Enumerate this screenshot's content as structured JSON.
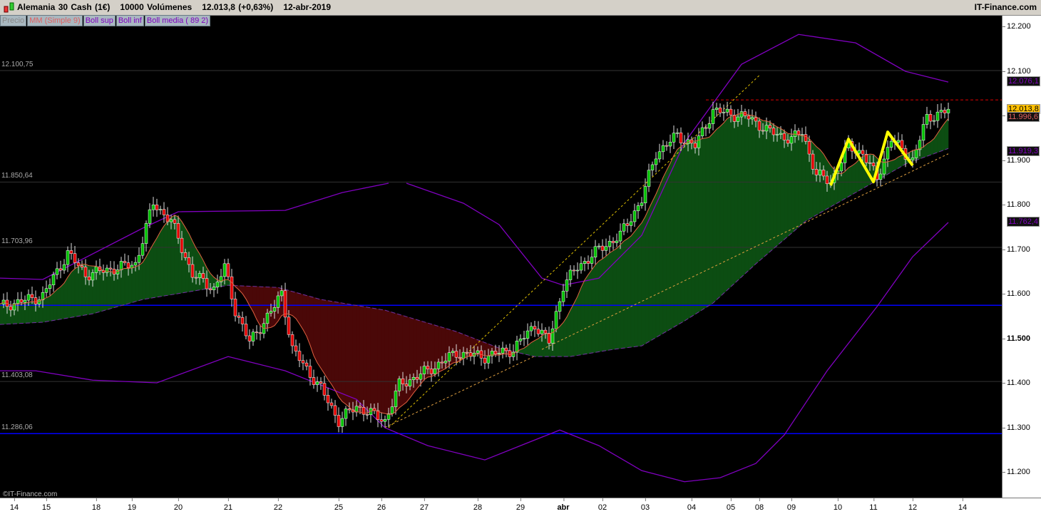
{
  "header": {
    "instrument": "Alemania 30 Cash (1€)",
    "volume": "10000 Volúmenes",
    "last": "12.013,8 (+0,63%)",
    "date": "12-abr-2019",
    "brand": "IT-Finance.com"
  },
  "legend": [
    {
      "label": "Precio",
      "color": "#888888"
    },
    {
      "label": "MM (Simple 9)",
      "color": "#e06060"
    },
    {
      "label": "Boll sup",
      "color": "#8000c0"
    },
    {
      "label": "Boll inf",
      "color": "#8000c0"
    },
    {
      "label": "Boll media ( 89 2)",
      "color": "#8000c0"
    }
  ],
  "copyright": "©IT-Finance.com",
  "levels": [
    {
      "label": "12.100,75",
      "price": 12100.75,
      "color": "#333333"
    },
    {
      "label": "11.850,64",
      "price": 11850.64,
      "color": "#333333"
    },
    {
      "label": "11.703,96",
      "price": 11703.96,
      "color": "#333333"
    },
    {
      "label": "11.403,08",
      "price": 11403.08,
      "color": "#333333"
    },
    {
      "label": "11.286,06",
      "price": 11286.06,
      "color": "#0000ff"
    }
  ],
  "chart_data": {
    "type": "candlestick",
    "title": "Alemania 30 Cash (1€)",
    "ylim": [
      11100,
      12230
    ],
    "yticks": [
      "12.200",
      "12.100",
      "12.000",
      "11.900",
      "11.800",
      "11.700",
      "11.600",
      "11.500",
      "11.400",
      "11.300",
      "11.200"
    ],
    "ytick_values": [
      12200,
      12100,
      12000,
      11900,
      11800,
      11700,
      11600,
      11500,
      11400,
      11300,
      11200
    ],
    "xticks": [
      {
        "label": "14",
        "bar": 4
      },
      {
        "label": "15",
        "bar": 13
      },
      {
        "label": "18",
        "bar": 27
      },
      {
        "label": "19",
        "bar": 37
      },
      {
        "label": "20",
        "bar": 50
      },
      {
        "label": "21",
        "bar": 64
      },
      {
        "label": "22",
        "bar": 78
      },
      {
        "label": "25",
        "bar": 95
      },
      {
        "label": "26",
        "bar": 107
      },
      {
        "label": "27",
        "bar": 119
      },
      {
        "label": "28",
        "bar": 134
      },
      {
        "label": "29",
        "bar": 146
      },
      {
        "label": "abr",
        "bar": 158
      },
      {
        "label": "02",
        "bar": 169
      },
      {
        "label": "03",
        "bar": 181
      },
      {
        "label": "04",
        "bar": 194
      },
      {
        "label": "05",
        "bar": 205
      },
      {
        "label": "08",
        "bar": 213
      },
      {
        "label": "09",
        "bar": 222
      },
      {
        "label": "10",
        "bar": 235
      },
      {
        "label": "11",
        "bar": 245
      },
      {
        "label": "12",
        "bar": 256
      },
      {
        "label": "14",
        "bar": 270
      }
    ],
    "close": [
      [
        0,
        11571
      ],
      [
        12,
        11595
      ],
      [
        19,
        11691
      ],
      [
        24,
        11643
      ],
      [
        38,
        11667
      ],
      [
        43,
        11803
      ],
      [
        48,
        11763
      ],
      [
        54,
        11643
      ],
      [
        60,
        11611
      ],
      [
        63,
        11659
      ],
      [
        66,
        11563
      ],
      [
        70,
        11491
      ],
      [
        77,
        11571
      ],
      [
        79,
        11603
      ],
      [
        82,
        11475
      ],
      [
        90,
        11387
      ],
      [
        95,
        11315
      ],
      [
        100,
        11347
      ],
      [
        108,
        11315
      ],
      [
        112,
        11395
      ],
      [
        120,
        11427
      ],
      [
        128,
        11467
      ],
      [
        136,
        11459
      ],
      [
        144,
        11475
      ],
      [
        150,
        11531
      ],
      [
        154,
        11491
      ],
      [
        158,
        11619
      ],
      [
        162,
        11659
      ],
      [
        168,
        11699
      ],
      [
        174,
        11731
      ],
      [
        180,
        11811
      ],
      [
        184,
        11915
      ],
      [
        190,
        11955
      ],
      [
        195,
        11931
      ],
      [
        200,
        12011
      ],
      [
        210,
        11995
      ],
      [
        216,
        11963
      ],
      [
        222,
        11947
      ],
      [
        225,
        11963
      ],
      [
        229,
        11867
      ],
      [
        233,
        11851
      ],
      [
        238,
        11931
      ],
      [
        242,
        11915
      ],
      [
        246,
        11859
      ],
      [
        250,
        11947
      ],
      [
        256,
        11899
      ],
      [
        260,
        11995
      ],
      [
        266,
        12011
      ]
    ],
    "boll_sup": [
      [
        0,
        11635
      ],
      [
        12,
        11632
      ],
      [
        40,
        11747
      ],
      [
        50,
        11784
      ],
      [
        80,
        11787
      ],
      [
        96,
        11827
      ],
      [
        109,
        11848
      ]
    ],
    "boll_sup_2": [
      [
        114,
        11848
      ],
      [
        130,
        11803
      ],
      [
        140,
        11755
      ],
      [
        152,
        11635
      ],
      [
        158,
        11619
      ],
      [
        168,
        11635
      ],
      [
        180,
        11731
      ],
      [
        192,
        11939
      ],
      [
        208,
        12115
      ],
      [
        224,
        12182
      ],
      [
        240,
        12163
      ],
      [
        254,
        12099
      ],
      [
        266,
        12075
      ]
    ],
    "boll_inf": [
      [
        0,
        11427
      ],
      [
        10,
        11427
      ],
      [
        26,
        11406
      ],
      [
        44,
        11400
      ],
      [
        64,
        11459
      ],
      [
        80,
        11427
      ],
      [
        100,
        11363
      ],
      [
        108,
        11299
      ],
      [
        120,
        11259
      ],
      [
        136,
        11227
      ],
      [
        146,
        11259
      ],
      [
        157,
        11294
      ],
      [
        168,
        11259
      ],
      [
        180,
        11203
      ],
      [
        192,
        11178
      ],
      [
        202,
        11187
      ],
      [
        212,
        11219
      ],
      [
        220,
        11283
      ],
      [
        232,
        11427
      ],
      [
        246,
        11571
      ],
      [
        256,
        11683
      ],
      [
        266,
        11760
      ]
    ],
    "boll_media": [
      [
        0,
        11531
      ],
      [
        12,
        11536
      ],
      [
        26,
        11555
      ],
      [
        40,
        11587
      ],
      [
        52,
        11603
      ],
      [
        64,
        11619
      ],
      [
        78,
        11614
      ],
      [
        90,
        11587
      ],
      [
        108,
        11563
      ],
      [
        128,
        11515
      ],
      [
        140,
        11478
      ],
      [
        150,
        11459
      ],
      [
        160,
        11459
      ],
      [
        172,
        11475
      ],
      [
        180,
        11483
      ],
      [
        192,
        11539
      ],
      [
        200,
        11579
      ],
      [
        212,
        11667
      ],
      [
        226,
        11763
      ],
      [
        240,
        11827
      ],
      [
        254,
        11891
      ],
      [
        266,
        11926
      ]
    ],
    "price_tags": [
      {
        "label": "12.076,1",
        "price": 12076.1,
        "color": "#8000c0",
        "bg": "#111111"
      },
      {
        "label": "12.013,8",
        "price": 12013.8,
        "color": "#000000",
        "bg": "#ffc000"
      },
      {
        "label": "11.996,6",
        "price": 11996.6,
        "color": "#e06060",
        "bg": "#111111"
      },
      {
        "label": "11.919,3",
        "price": 11919.3,
        "color": "#8000c0",
        "bg": "#111111"
      },
      {
        "label": "11.762,4",
        "price": 11762.4,
        "color": "#8000c0",
        "bg": "#111111"
      }
    ],
    "resistance": {
      "price": 12035,
      "from_bar": 198
    },
    "trendlines": [
      {
        "from": [
          109,
          11299
        ],
        "to": [
          213,
          12090
        ],
        "color": "#e0c000"
      },
      {
        "from": [
          152,
          11475
        ],
        "to": [
          266,
          11914
        ],
        "color": "#e0a040"
      },
      {
        "from": [
          108,
          11300
        ],
        "to": [
          150,
          11460
        ],
        "color": "#e0a040"
      }
    ],
    "pattern": [
      [
        233,
        11843
      ],
      [
        238,
        11947
      ],
      [
        245,
        11851
      ],
      [
        249,
        11963
      ],
      [
        256,
        11888
      ]
    ],
    "colors": {
      "up": "#00c000",
      "down": "#e00000",
      "bull_fill": "#0c4d12",
      "bear_fill": "#4a0808",
      "ma": "#e06040",
      "boll": "#8000c0",
      "hline": "#0000ff"
    }
  }
}
